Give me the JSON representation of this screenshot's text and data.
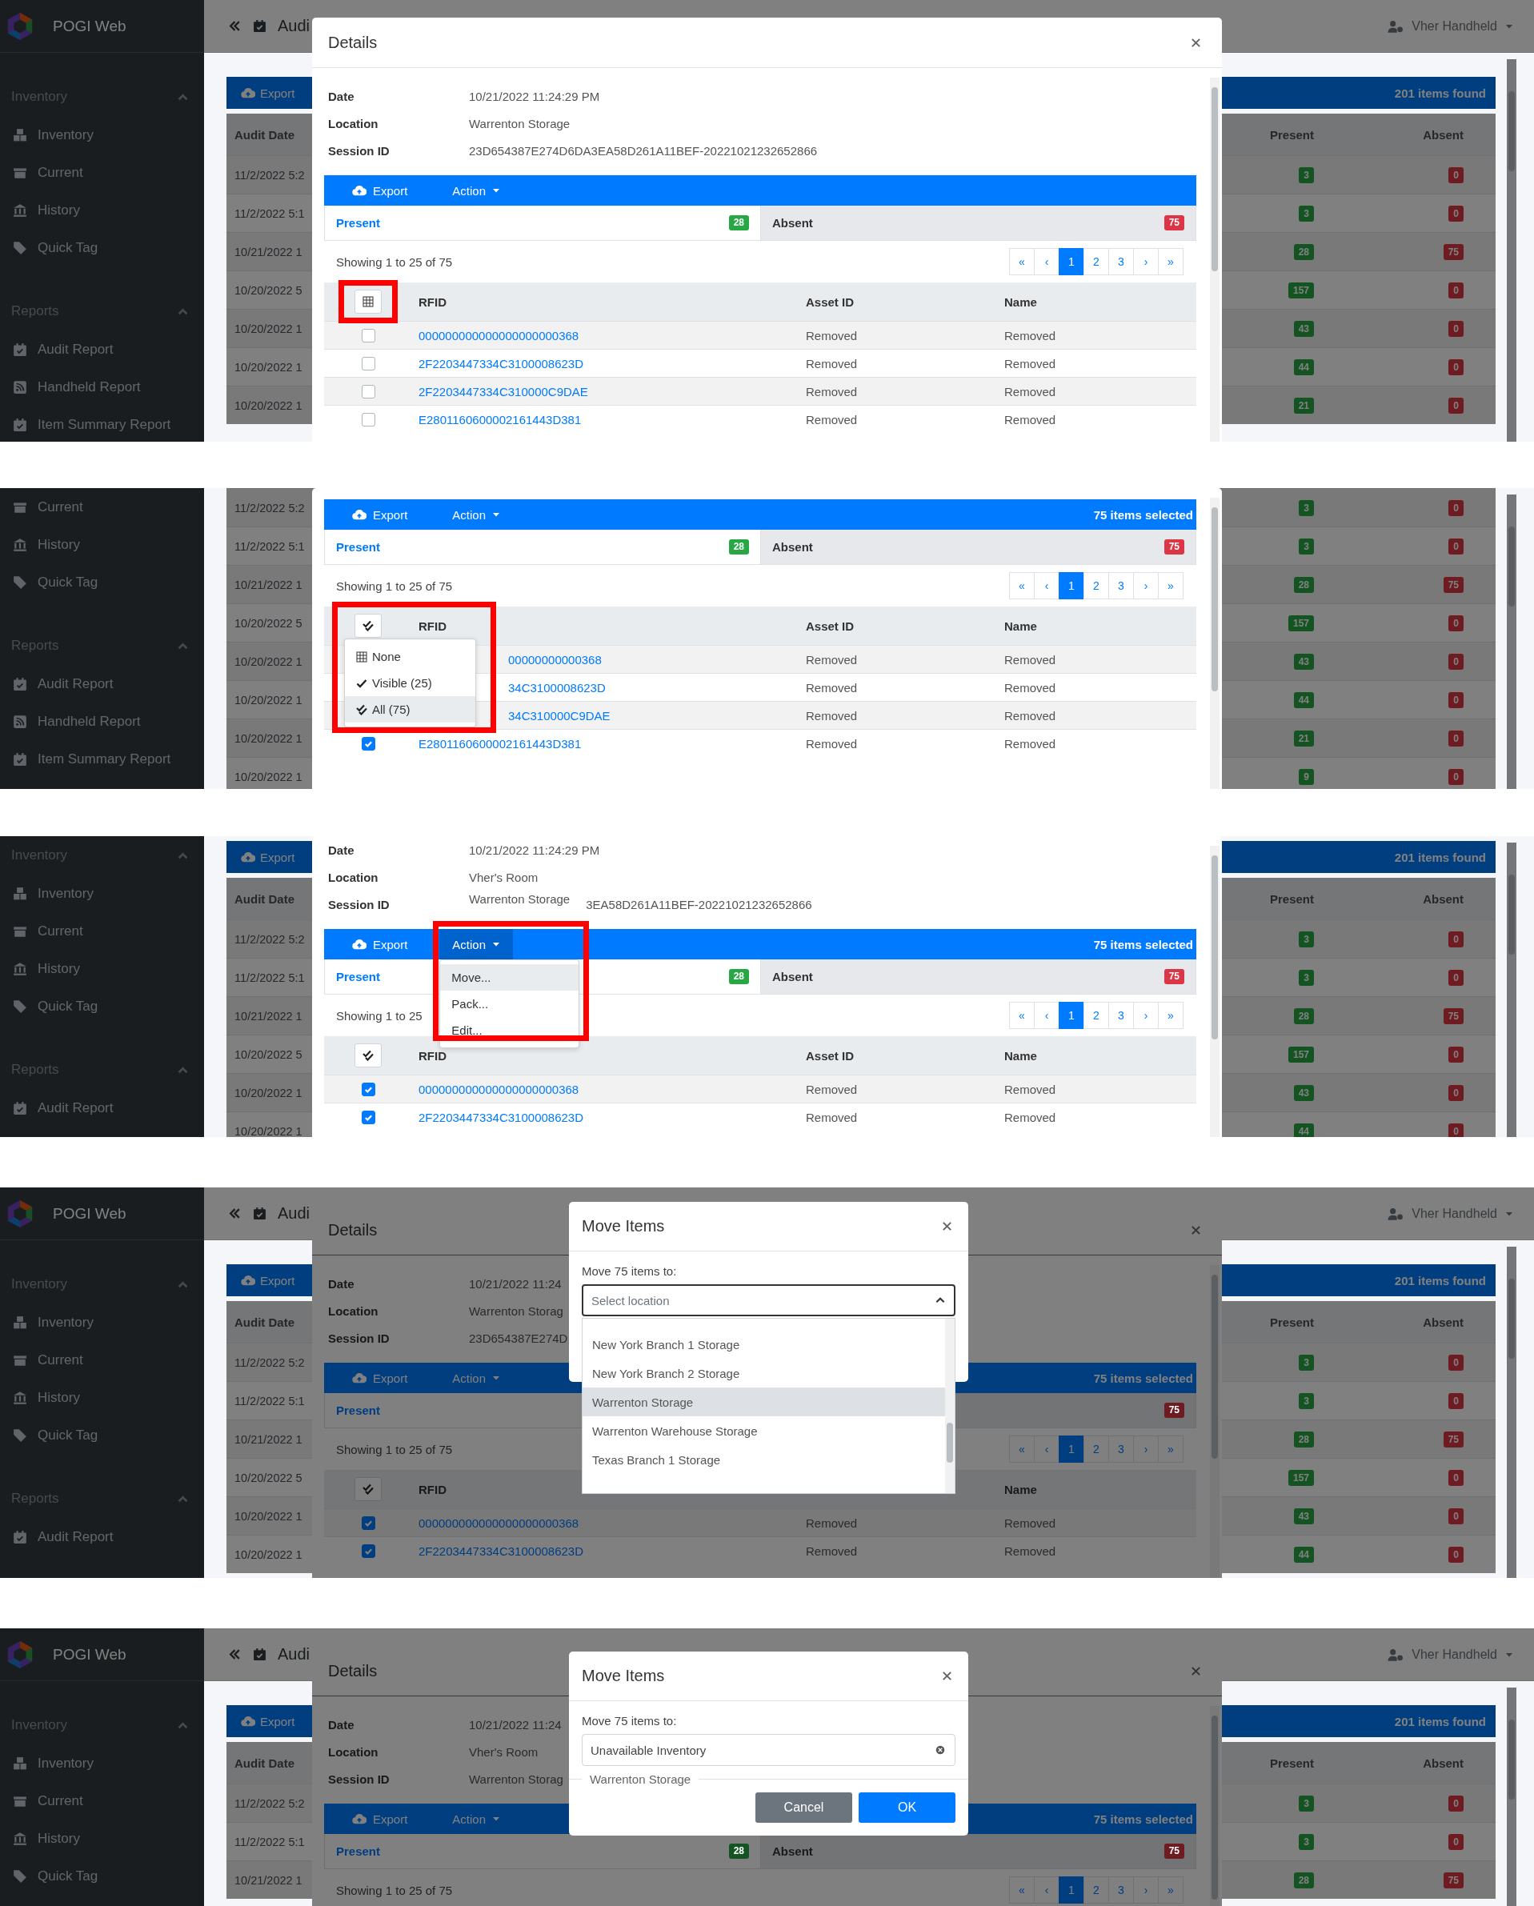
{
  "panels": [
    {
      "sidebar": {
        "brand": "POGI Web",
        "sections": [
          {
            "title": "Inventory",
            "expanded": true,
            "items": [
              {
                "label": "Inventory",
                "kind": "boxes"
              },
              {
                "label": "Current",
                "kind": "drawer"
              },
              {
                "label": "History",
                "kind": "bank"
              },
              {
                "label": "Quick Tag",
                "kind": "tags"
              }
            ]
          },
          {
            "title": "Reports",
            "expanded": true,
            "items": [
              {
                "label": "Audit Report",
                "kind": "calendar-check"
              },
              {
                "label": "Handheld Report",
                "kind": "feed"
              },
              {
                "label": "Item Summary Report",
                "kind": "calendar-check"
              }
            ]
          }
        ]
      },
      "topbar": {
        "title": "Audi",
        "user": "Vher Handheld"
      },
      "background": {
        "toolbar": {
          "export": "Export",
          "count": "201 items found"
        },
        "columns": [
          "Audit Date",
          "Present",
          "Absent"
        ],
        "rows": [
          {
            "date": "11/2/2022 5:2",
            "present": "3",
            "absent": "0"
          },
          {
            "date": "11/2/2022 5:1",
            "present": "3",
            "absent": "0"
          },
          {
            "date": "10/21/2022 1",
            "present": "28",
            "absent": "75"
          },
          {
            "date": "10/20/2022 5",
            "present": "157",
            "absent": "0"
          },
          {
            "date": "10/20/2022 1",
            "present": "43",
            "absent": "0"
          },
          {
            "date": "10/20/2022 1",
            "present": "44",
            "absent": "0"
          },
          {
            "date": "10/20/2022 1",
            "present": "21",
            "absent": "0"
          }
        ]
      },
      "details": {
        "title": "Details",
        "info": [
          {
            "label": "Date",
            "value": "10/21/2022 11:24:29 PM"
          },
          {
            "label": "Location",
            "value": "Warrenton Storage"
          },
          {
            "label": "Session ID",
            "value": "23D654387E274D6DA3EA58D261A11BEF-20221021232652866"
          }
        ],
        "toolbar": {
          "export": "Export",
          "action": "Action"
        },
        "tabs": [
          {
            "label": "Present",
            "count": "28",
            "color": "#28a745",
            "selected": true
          },
          {
            "label": "Absent",
            "count": "75",
            "color": "#dc3545",
            "selected": false
          }
        ],
        "showing": "Showing 1 to 25 of 75",
        "pager": [
          {
            "label": "«",
            "selected": false
          },
          {
            "label": "‹",
            "selected": false
          },
          {
            "label": "1",
            "selected": true
          },
          {
            "label": "2",
            "selected": false
          },
          {
            "label": "3",
            "selected": false
          },
          {
            "label": "›",
            "selected": false
          },
          {
            "label": "»",
            "selected": false
          }
        ],
        "table": {
          "all_selected": false,
          "highlighted": true,
          "headers": {
            "rfid": "RFID",
            "asset_id": "Asset ID",
            "name": "Name"
          },
          "rows": [
            {
              "rfid": "000000000000000000000368",
              "asset_id": "Removed",
              "name": "Removed",
              "checked": false
            },
            {
              "rfid": "2F2203447334C3100008623D",
              "asset_id": "Removed",
              "name": "Removed",
              "checked": false
            },
            {
              "rfid": "2F2203447334C310000C9DAE",
              "asset_id": "Removed",
              "name": "Removed",
              "checked": false
            },
            {
              "rfid": "E2801160600002161443D381",
              "asset_id": "Removed",
              "name": "Removed",
              "checked": false
            }
          ]
        }
      }
    },
    {
      "sidebar": {
        "sections": [
          {
            "items": [
              {
                "label": "Current",
                "kind": "drawer"
              },
              {
                "label": "History",
                "kind": "bank"
              },
              {
                "label": "Quick Tag",
                "kind": "tags"
              }
            ]
          },
          {
            "title": "Reports",
            "expanded": true,
            "items": [
              {
                "label": "Audit Report",
                "kind": "calendar-check"
              },
              {
                "label": "Handheld Report",
                "kind": "feed"
              },
              {
                "label": "Item Summary Report",
                "kind": "calendar-check"
              }
            ]
          }
        ]
      },
      "background": {
        "rows": [
          {
            "date": "11/2/2022 5:2",
            "present": "3",
            "absent": "0"
          },
          {
            "date": "11/2/2022 5:1",
            "present": "3",
            "absent": "0"
          },
          {
            "date": "10/21/2022 1",
            "present": "28",
            "absent": "75"
          },
          {
            "date": "10/20/2022 5",
            "present": "157",
            "absent": "0"
          },
          {
            "date": "10/20/2022 1",
            "present": "43",
            "absent": "0"
          },
          {
            "date": "10/20/2022 1",
            "present": "44",
            "absent": "0"
          },
          {
            "date": "10/20/2022 1",
            "present": "21",
            "absent": "0"
          },
          {
            "date": "10/20/2022 1",
            "present": "9",
            "absent": "0"
          }
        ]
      },
      "details": {
        "toolbar": {
          "export": "Export",
          "action": "Action",
          "status": "75 items selected"
        },
        "tabs": [
          {
            "label": "Present",
            "count": "28",
            "color": "#28a745",
            "selected": true
          },
          {
            "label": "Absent",
            "count": "75",
            "color": "#dc3545",
            "selected": false
          }
        ],
        "showing": "Showing 1 to 25 of 75",
        "pager": [
          {
            "label": "«",
            "selected": false
          },
          {
            "label": "‹",
            "selected": false
          },
          {
            "label": "1",
            "selected": true
          },
          {
            "label": "2",
            "selected": false
          },
          {
            "label": "3",
            "selected": false
          },
          {
            "label": "›",
            "selected": false
          },
          {
            "label": "»",
            "selected": false
          }
        ],
        "table": {
          "all_selected": true,
          "headers": {
            "rfid": "RFID",
            "asset_id": "Asset ID",
            "name": "Name"
          },
          "rows": [
            {
              "rfid": "00000000000368",
              "asset_id": "Removed",
              "name": "Removed"
            },
            {
              "rfid": "34C3100008623D",
              "asset_id": "Removed",
              "name": "Removed"
            },
            {
              "rfid": "34C310000C9DAE",
              "asset_id": "Removed",
              "name": "Removed"
            },
            {
              "rfid": "E2801160600002161443D381",
              "asset_id": "Removed",
              "name": "Removed",
              "checked": true
            }
          ]
        },
        "select_menu": {
          "highlighted": true,
          "items": [
            {
              "label": "None",
              "kind": "grid",
              "selected": false
            },
            {
              "label": "Visible (25)",
              "kind": "check",
              "selected": false
            },
            {
              "label": "All (75)",
              "kind": "double-check",
              "selected": true
            }
          ]
        }
      }
    },
    {
      "sidebar": {
        "sections": [
          {
            "title": "Inventory",
            "expanded": true,
            "items": [
              {
                "label": "Inventory",
                "kind": "boxes"
              },
              {
                "label": "Current",
                "kind": "drawer"
              },
              {
                "label": "History",
                "kind": "bank"
              },
              {
                "label": "Quick Tag",
                "kind": "tags"
              }
            ]
          },
          {
            "title": "Reports",
            "expanded": true,
            "items": [
              {
                "label": "Audit Report",
                "kind": "calendar-check"
              }
            ]
          }
        ]
      },
      "background": {
        "toolbar": {
          "export": "Export",
          "count": "201 items found"
        },
        "columns": [
          "Audit Date",
          "Present",
          "Absent"
        ],
        "rows": [
          {
            "date": "11/2/2022 5:2",
            "present": "3",
            "absent": "0"
          },
          {
            "date": "11/2/2022 5:1",
            "present": "3",
            "absent": "0"
          },
          {
            "date": "10/21/2022 1",
            "present": "28",
            "absent": "75"
          },
          {
            "date": "10/20/2022 5",
            "present": "157",
            "absent": "0"
          },
          {
            "date": "10/20/2022 1",
            "present": "43",
            "absent": "0"
          },
          {
            "date": "10/20/2022 1",
            "present": "44",
            "absent": "0"
          }
        ]
      },
      "details": {
        "info": [
          {
            "label": "Date",
            "value": "10/21/2022 11:24:29 PM"
          },
          {
            "label": "Location",
            "value": "Vher's Room"
          },
          {
            "label": "Session ID",
            "value": "3EA58D261A11BEF-20221021232652866",
            "note": "Warrenton Storage"
          }
        ],
        "toolbar": {
          "export": "Export",
          "action": "Action",
          "status": "75 items selected"
        },
        "action_menu": {
          "highlighted": true,
          "items": [
            {
              "label": "Move...",
              "selected": true
            },
            {
              "label": "Pack...",
              "selected": false
            },
            {
              "label": "Edit...",
              "selected": false
            }
          ]
        },
        "tabs": [
          {
            "label": "Present",
            "count": "28",
            "color": "#28a745",
            "selected": true
          },
          {
            "label": "Absent",
            "count": "75",
            "color": "#dc3545",
            "selected": false
          }
        ],
        "showing": "Showing 1 to 25",
        "pager": [
          {
            "label": "«",
            "selected": false
          },
          {
            "label": "‹",
            "selected": false
          },
          {
            "label": "1",
            "selected": true
          },
          {
            "label": "2",
            "selected": false
          },
          {
            "label": "3",
            "selected": false
          },
          {
            "label": "›",
            "selected": false
          },
          {
            "label": "»",
            "selected": false
          }
        ],
        "table": {
          "all_selected": true,
          "headers": {
            "rfid": "RFID",
            "asset_id": "Asset ID",
            "name": "Name"
          },
          "rows": [
            {
              "rfid": "000000000000000000000368",
              "asset_id": "Removed",
              "name": "Removed",
              "checked": true
            },
            {
              "rfid": "2F2203447334C3100008623D",
              "asset_id": "Removed",
              "name": "Removed",
              "checked": true
            }
          ]
        }
      }
    },
    {
      "sidebar": {
        "brand": "POGI Web",
        "sections": [
          {
            "title": "Inventory",
            "expanded": true,
            "items": [
              {
                "label": "Inventory",
                "kind": "boxes"
              },
              {
                "label": "Current",
                "kind": "drawer"
              },
              {
                "label": "History",
                "kind": "bank"
              },
              {
                "label": "Quick Tag",
                "kind": "tags"
              }
            ]
          },
          {
            "title": "Reports",
            "expanded": true,
            "items": [
              {
                "label": "Audit Report",
                "kind": "calendar-check"
              }
            ]
          }
        ]
      },
      "topbar": {
        "title": "Audi",
        "user": "Vher Handheld"
      },
      "background": {
        "toolbar": {
          "export": "Export",
          "count": "201 items found"
        },
        "columns": [
          "Audit Date",
          "Present",
          "Absent"
        ],
        "rows": [
          {
            "date": "11/2/2022 5:2",
            "present": "3",
            "absent": "0"
          },
          {
            "date": "11/2/2022 5:1",
            "present": "3",
            "absent": "0"
          },
          {
            "date": "10/21/2022 1",
            "present": "28",
            "absent": "75"
          },
          {
            "date": "10/20/2022 5",
            "present": "157",
            "absent": "0"
          },
          {
            "date": "10/20/2022 1",
            "present": "43",
            "absent": "0"
          },
          {
            "date": "10/20/2022 1",
            "present": "44",
            "absent": "0"
          }
        ]
      },
      "details": {
        "title": "Details",
        "info": [
          {
            "label": "Date",
            "value": "10/21/2022 11:24"
          },
          {
            "label": "Location",
            "value": "Warrenton Storag"
          },
          {
            "label": "Session ID",
            "value": "23D654387E274D"
          }
        ],
        "toolbar": {
          "export": "Export",
          "action": "Action",
          "status": "75 items selected"
        },
        "tabs": [
          {
            "label": "Present",
            "selected": true
          },
          {
            "count": "75",
            "color": "#6e1b22",
            "selected": false
          }
        ],
        "showing": "Showing 1 to 25 of 75",
        "pager": [
          {
            "label": "«",
            "selected": false
          },
          {
            "label": "‹",
            "selected": false
          },
          {
            "label": "1",
            "selected": true
          },
          {
            "label": "2",
            "selected": false
          },
          {
            "label": "3",
            "selected": false
          },
          {
            "label": "›",
            "selected": false
          },
          {
            "label": "»",
            "selected": false
          }
        ],
        "table": {
          "all_selected": true,
          "headers": {
            "rfid": "RFID",
            "name": "Name"
          },
          "rows": [
            {
              "rfid": "000000000000000000000368",
              "asset_id": "Removed",
              "name": "Removed",
              "checked": true
            },
            {
              "rfid": "2F2203447334C3100008623D",
              "asset_id": "Removed",
              "name": "Removed",
              "checked": true
            }
          ]
        }
      },
      "move_dialog": {
        "title": "Move Items",
        "label": "Move 75 items to:",
        "field": {
          "placeholder": "Select location"
        },
        "options": [
          {
            "label": "New York Branch 1 Storage",
            "selected": false
          },
          {
            "label": "New York Branch 2 Storage",
            "selected": false
          },
          {
            "label": "Warrenton Storage",
            "selected": true
          },
          {
            "label": "Warrenton Warehouse Storage",
            "selected": false
          },
          {
            "label": "Texas Branch 1 Storage",
            "selected": false
          }
        ]
      }
    },
    {
      "sidebar": {
        "brand": "POGI Web",
        "sections": [
          {
            "title": "Inventory",
            "expanded": true,
            "items": [
              {
                "label": "Inventory",
                "kind": "boxes"
              },
              {
                "label": "Current",
                "kind": "drawer"
              },
              {
                "label": "History",
                "kind": "bank"
              },
              {
                "label": "Quick Tag",
                "kind": "tags"
              }
            ]
          }
        ]
      },
      "topbar": {
        "title": "Audi",
        "user": "Vher Handheld"
      },
      "background": {
        "toolbar": {
          "export": "Export",
          "count": "201 items found"
        },
        "columns": [
          "Audit Date",
          "Present",
          "Absent"
        ],
        "rows": [
          {
            "date": "11/2/2022 5:2",
            "present": "3",
            "absent": "0"
          },
          {
            "date": "11/2/2022 5:1",
            "present": "3",
            "absent": "0"
          },
          {
            "date": "10/21/2022 1",
            "present": "28",
            "absent": "75"
          }
        ]
      },
      "details": {
        "title": "Details",
        "info": [
          {
            "label": "Date",
            "value": "10/21/2022 11:24"
          },
          {
            "label": "Location",
            "value": "Vher's Room"
          },
          {
            "label": "Session ID",
            "value": "Warrenton Storag"
          }
        ],
        "toolbar": {
          "export": "Export",
          "action": "Action",
          "status": "75 items selected"
        },
        "tabs": [
          {
            "label": "Present",
            "count": "28",
            "color": "#145422",
            "selected": true
          },
          {
            "label": "Absent",
            "count": "75",
            "color": "#6e1b22",
            "selected": false
          }
        ],
        "showing": "Showing 1 to 25 of 75",
        "pager": [
          {
            "label": "«",
            "selected": false
          },
          {
            "label": "‹",
            "selected": false
          },
          {
            "label": "1",
            "selected": true
          },
          {
            "label": "2",
            "selected": false
          },
          {
            "label": "3",
            "selected": false
          },
          {
            "label": "›",
            "selected": false
          },
          {
            "label": "»",
            "selected": false
          }
        ]
      },
      "move_dialog": {
        "title": "Move Items",
        "label": "Move 75 items to:",
        "field": {
          "value": "Unavailable Inventory"
        },
        "note": "Warrenton Storage",
        "buttons": [
          {
            "label": "Cancel",
            "kind": "secondary"
          },
          {
            "label": "OK",
            "kind": "primary"
          }
        ]
      }
    }
  ]
}
